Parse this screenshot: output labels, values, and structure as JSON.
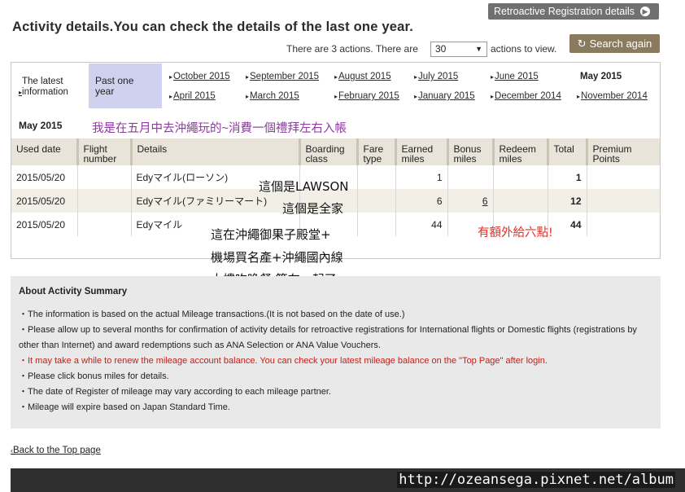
{
  "header": {
    "retro_button": "Retroactive Registration details",
    "title": "Activity details.You can check the details of the last one year.",
    "actions_text": "There are 3 actions. There are",
    "actions_select": "30",
    "actions_suffix": "actions to view.",
    "search_button": "Search again"
  },
  "nav": {
    "latest": "The latest information",
    "past_year": "Past one year",
    "months_row1": [
      "October 2015",
      "September 2015",
      "August 2015",
      "July 2015",
      "June 2015"
    ],
    "current_month": "May 2015",
    "months_row2": [
      "April 2015",
      "March 2015",
      "February 2015",
      "January 2015",
      "December 2014",
      "November 2014"
    ]
  },
  "month_label": "May 2015",
  "annotations": {
    "top": "我是在五月中去沖繩玩的~消費一個禮拜左右入帳",
    "row1": "這個是LAWSON",
    "row2": "這個是全家",
    "row3_line1": "這在沖繩御果子殿堂+",
    "row3_line2": "機場買名產+沖繩國內線",
    "row3_line3": "大樓吃晚餐 算在一起了",
    "bonus_note": "有額外給六點!"
  },
  "table": {
    "headers": [
      "Used date",
      "Flight number",
      "Details",
      "Boarding class",
      "Fare type",
      "Earned miles",
      "Bonus miles",
      "Redeem miles",
      "Total",
      "Premium Points"
    ],
    "rows": [
      {
        "date": "2015/05/20",
        "flight": "",
        "details": "Edyマイル(ローソン)",
        "boarding": "",
        "fare": "",
        "earned": "1",
        "bonus": "",
        "redeem": "",
        "total": "1",
        "premium": ""
      },
      {
        "date": "2015/05/20",
        "flight": "",
        "details": "Edyマイル(ファミリーマート)",
        "boarding": "",
        "fare": "",
        "earned": "6",
        "bonus": "6",
        "redeem": "",
        "total": "12",
        "premium": ""
      },
      {
        "date": "2015/05/20",
        "flight": "",
        "details": "Edyマイル",
        "boarding": "",
        "fare": "",
        "earned": "44",
        "bonus": "",
        "redeem": "",
        "total": "44",
        "premium": ""
      }
    ]
  },
  "summary": {
    "title": "About Activity Summary",
    "items": [
      "The information is based on the actual Mileage transactions.(It is not based on the date of use.)",
      "Please allow up to several months for confirmation of activity details for retroactive registrations for International flights or Domestic flights (registrations by other than Internet) and award redemptions such as ANA Selection or ANA Value Vouchers.",
      "It may take a while to renew the mileage account balance. You can check your latest mileage balance on the \"Top Page\" after login.",
      "Please click bonus miles for details.",
      "The date of Register of mileage may vary according to each mileage partner.",
      "Mileage will expire based on Japan Standard Time."
    ]
  },
  "back_link": "Back to the Top page",
  "watermark": "http://ozeansega.pixnet.net/album",
  "colors": {
    "past_tab": "#cfd2ef",
    "header_bg": "#e8e4d9",
    "annotation_purple": "#8c3c9e",
    "annotation_red": "#e8302a",
    "notice_red": "#c0201a"
  }
}
